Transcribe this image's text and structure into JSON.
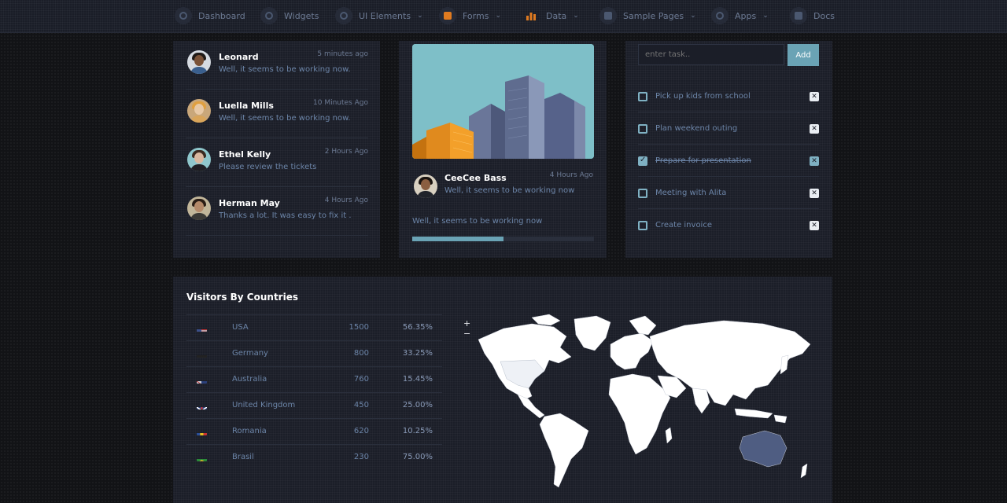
{
  "nav": [
    {
      "label": "Dashboard",
      "icon": "dashboard-icon"
    },
    {
      "label": "Widgets",
      "icon": "widgets-icon"
    },
    {
      "label": "UI Elements",
      "icon": "ui-elements-icon"
    },
    {
      "label": "Forms",
      "icon": "forms-icon"
    },
    {
      "label": "Data",
      "icon": "data-chart-icon"
    },
    {
      "label": "Sample Pages",
      "icon": "sample-pages-icon"
    },
    {
      "label": "Apps",
      "icon": "apps-icon"
    },
    {
      "label": "Docs",
      "icon": "docs-icon"
    }
  ],
  "chats": [
    {
      "name": "Leonard",
      "time": "5 minutes ago",
      "message": "Well, it seems to be working now."
    },
    {
      "name": "Luella Mills",
      "time": "10 Minutes Ago",
      "message": "Well, it seems to be working now."
    },
    {
      "name": "Ethel Kelly",
      "time": "2 Hours Ago",
      "message": "Please review the tickets"
    },
    {
      "name": "Herman May",
      "time": "4 Hours Ago",
      "message": "Thanks a lot. It was easy to fix it ."
    }
  ],
  "post": {
    "author": "CeeCee Bass",
    "time": "4 Hours Ago",
    "author_message": "Well, it seems to be working now",
    "body": "Well, it seems to be working now",
    "progress": 0.5
  },
  "todo": {
    "placeholder": "enter task..",
    "add_label": "Add",
    "items": [
      {
        "label": "Pick up kids from school",
        "done": false
      },
      {
        "label": "Plan weekend outing",
        "done": false
      },
      {
        "label": "Prepare for presentation",
        "done": true
      },
      {
        "label": "Meeting with Alita",
        "done": false
      },
      {
        "label": "Create invoice",
        "done": false
      }
    ],
    "delete_symbol": "✕"
  },
  "visitors": {
    "title": "Visitors By Countries",
    "rows": [
      {
        "country": "USA",
        "count": "1500",
        "percent": "56.35%",
        "flag": "usa-flag"
      },
      {
        "country": "Germany",
        "count": "800",
        "percent": "33.25%",
        "flag": "germany-flag"
      },
      {
        "country": "Australia",
        "count": "760",
        "percent": "15.45%",
        "flag": "australia-flag"
      },
      {
        "country": "United Kingdom",
        "count": "450",
        "percent": "25.00%",
        "flag": "uk-flag"
      },
      {
        "country": "Romania",
        "count": "620",
        "percent": "10.25%",
        "flag": "romania-flag"
      },
      {
        "country": "Brasil",
        "count": "230",
        "percent": "75.00%",
        "flag": "brasil-flag"
      }
    ],
    "zoom_in": "+",
    "zoom_out": "−"
  },
  "colors": {
    "accent": "#6aa3b5",
    "card": "#1b1e28",
    "background": "#121316",
    "forms_icon": "#e07b20",
    "map_land": "#ffffff",
    "map_highlight": "#4f5d82"
  }
}
